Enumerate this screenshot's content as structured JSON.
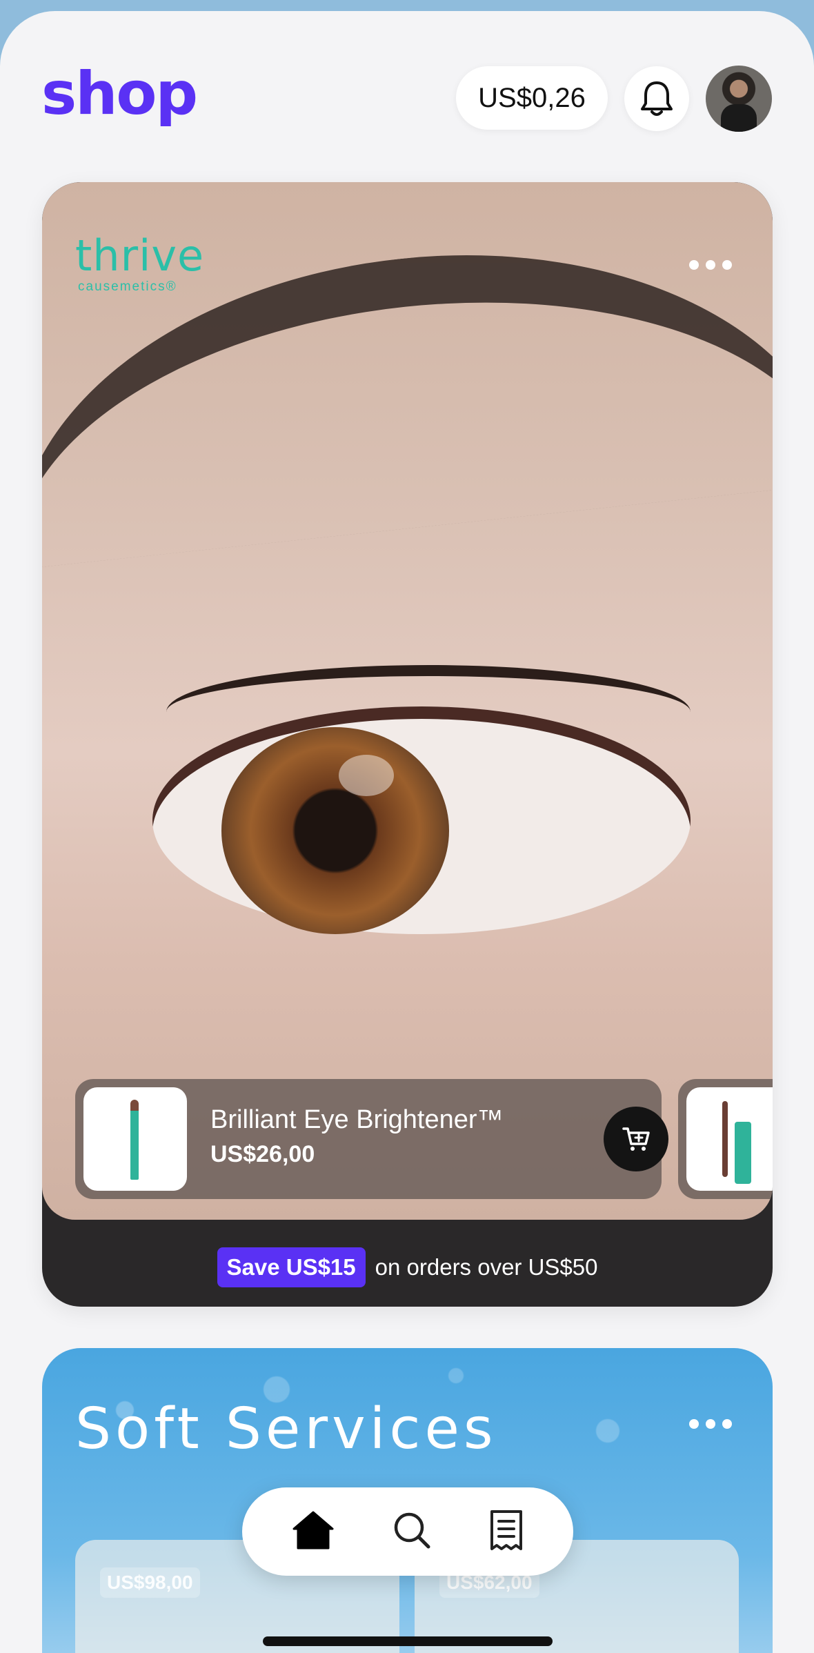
{
  "header": {
    "logo": "shop",
    "balance": "US$0,26"
  },
  "feature_card": {
    "brand_name": "thrive",
    "brand_sub": "causemetics®",
    "products": [
      {
        "name": "Brilliant Eye Brightener™",
        "price": "US$26,00"
      }
    ],
    "promo_badge": "Save US$15",
    "promo_text": "on orders over US$50"
  },
  "store_card": {
    "title": "Soft Services",
    "items": [
      {
        "price": "US$98,00"
      },
      {
        "price": "US$62,00"
      }
    ]
  },
  "tabbar": {
    "tabs": [
      "home",
      "search",
      "orders"
    ],
    "active": "home"
  }
}
